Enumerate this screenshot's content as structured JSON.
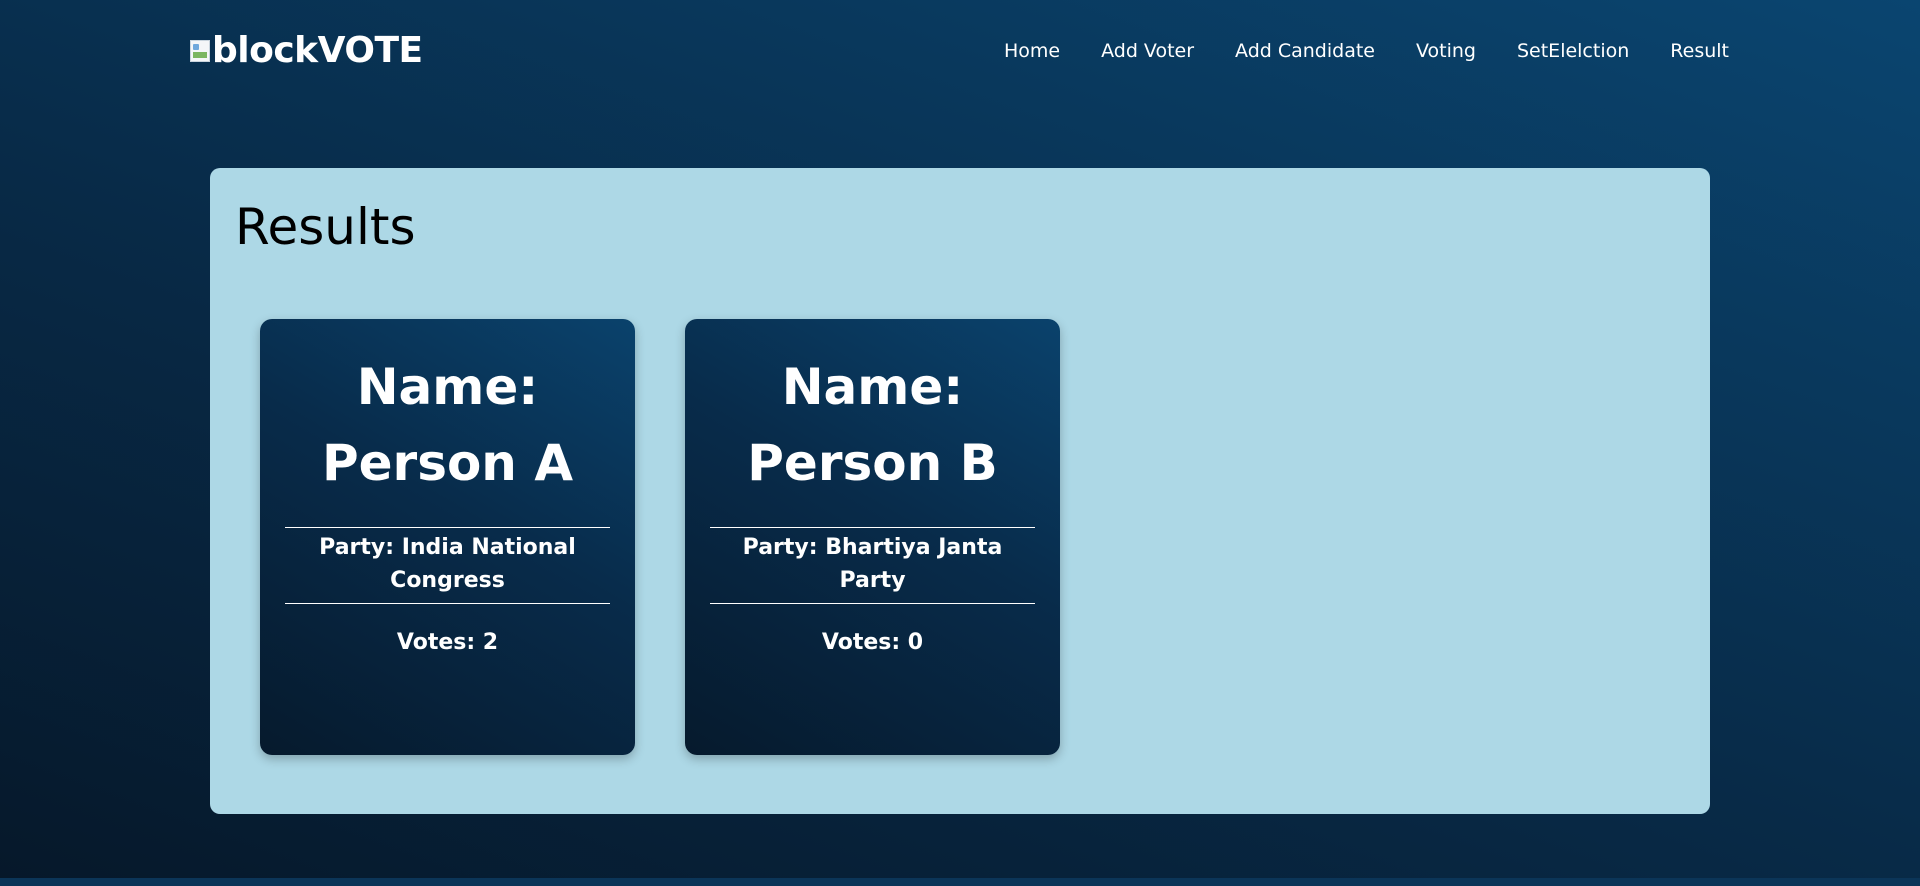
{
  "navbar": {
    "logo_text": "blockVOTE",
    "logo_icon": "broken-image-icon",
    "links": [
      "Home",
      "Add Voter",
      "Add Candidate",
      "Voting",
      "SetElelction",
      "Result"
    ]
  },
  "results": {
    "title": "Results",
    "candidates": [
      {
        "name_label": "Name:",
        "name": "Person A",
        "party": "Party: India National Congress",
        "votes": "Votes: 2"
      },
      {
        "name_label": "Name:",
        "name": "Person B",
        "party": "Party: Bhartiya Janta Party",
        "votes": "Votes: 0"
      }
    ]
  },
  "colors": {
    "panel_background": "#add8e6",
    "card_gradient_dark": "#061a2d",
    "card_gradient_light": "#0a426c",
    "page_gradient_dark": "#06182a",
    "page_gradient_light": "#0a4570"
  }
}
